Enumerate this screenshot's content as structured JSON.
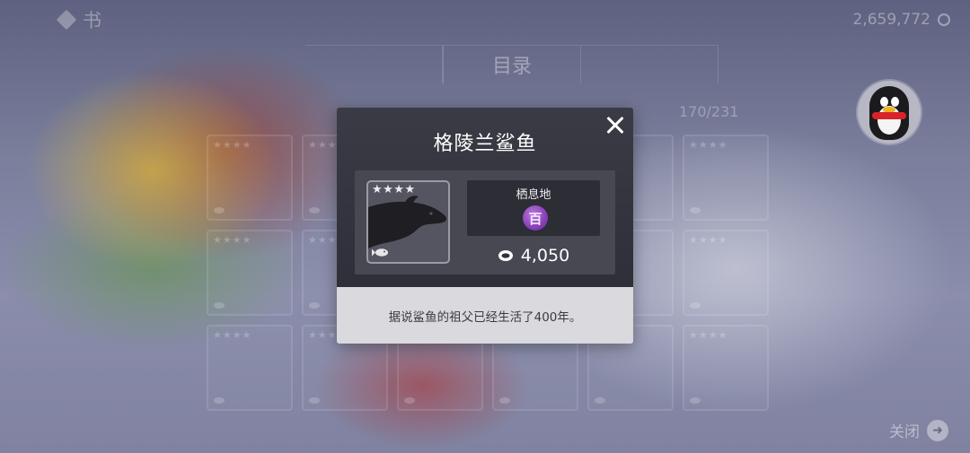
{
  "background": {
    "book_label": "书",
    "coin_total": "2,659,772",
    "catalog_tabs": [
      "",
      "目录",
      ""
    ],
    "collection_count": "170/231",
    "close_label": "关闭"
  },
  "modal": {
    "title": "格陵兰鲨鱼",
    "stars": "★★★★",
    "habitat_label": "栖息地",
    "habitat_glyph": "百",
    "price": "4,050",
    "description": "据说鲨鱼的祖父已经生活了400年。"
  },
  "colors": {
    "modal_dark": "#2e2f38",
    "panel": "#474852",
    "description_bg": "#d9d9de",
    "habitat_purple": "#8a3eb8"
  },
  "icons": {
    "close": "close-icon",
    "coin": "coin-icon",
    "fish": "fish-icon",
    "habitat": "habitat-icon",
    "book": "book-icon",
    "avatar": "penguin-avatar"
  }
}
